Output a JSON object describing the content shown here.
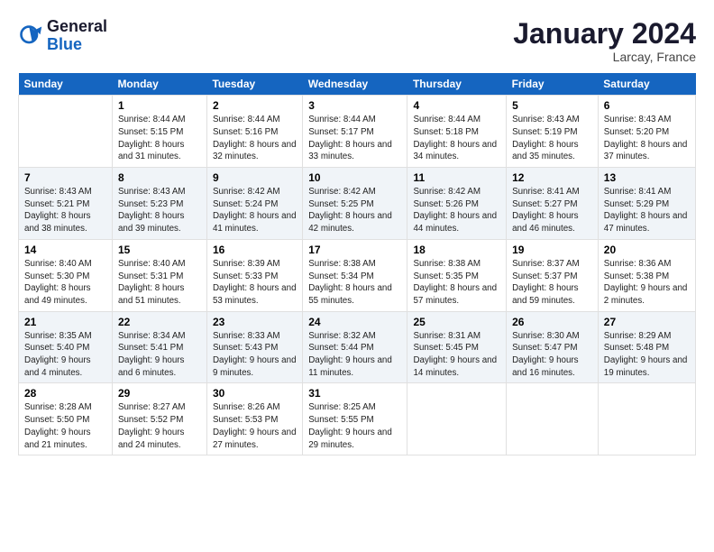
{
  "logo": {
    "line1": "General",
    "line2": "Blue"
  },
  "title": "January 2024",
  "location": "Larcay, France",
  "weekdays": [
    "Sunday",
    "Monday",
    "Tuesday",
    "Wednesday",
    "Thursday",
    "Friday",
    "Saturday"
  ],
  "weeks": [
    [
      {
        "day": "",
        "sunrise": "",
        "sunset": "",
        "daylight": ""
      },
      {
        "day": "1",
        "sunrise": "Sunrise: 8:44 AM",
        "sunset": "Sunset: 5:15 PM",
        "daylight": "Daylight: 8 hours and 31 minutes."
      },
      {
        "day": "2",
        "sunrise": "Sunrise: 8:44 AM",
        "sunset": "Sunset: 5:16 PM",
        "daylight": "Daylight: 8 hours and 32 minutes."
      },
      {
        "day": "3",
        "sunrise": "Sunrise: 8:44 AM",
        "sunset": "Sunset: 5:17 PM",
        "daylight": "Daylight: 8 hours and 33 minutes."
      },
      {
        "day": "4",
        "sunrise": "Sunrise: 8:44 AM",
        "sunset": "Sunset: 5:18 PM",
        "daylight": "Daylight: 8 hours and 34 minutes."
      },
      {
        "day": "5",
        "sunrise": "Sunrise: 8:43 AM",
        "sunset": "Sunset: 5:19 PM",
        "daylight": "Daylight: 8 hours and 35 minutes."
      },
      {
        "day": "6",
        "sunrise": "Sunrise: 8:43 AM",
        "sunset": "Sunset: 5:20 PM",
        "daylight": "Daylight: 8 hours and 37 minutes."
      }
    ],
    [
      {
        "day": "7",
        "sunrise": "Sunrise: 8:43 AM",
        "sunset": "Sunset: 5:21 PM",
        "daylight": "Daylight: 8 hours and 38 minutes."
      },
      {
        "day": "8",
        "sunrise": "Sunrise: 8:43 AM",
        "sunset": "Sunset: 5:23 PM",
        "daylight": "Daylight: 8 hours and 39 minutes."
      },
      {
        "day": "9",
        "sunrise": "Sunrise: 8:42 AM",
        "sunset": "Sunset: 5:24 PM",
        "daylight": "Daylight: 8 hours and 41 minutes."
      },
      {
        "day": "10",
        "sunrise": "Sunrise: 8:42 AM",
        "sunset": "Sunset: 5:25 PM",
        "daylight": "Daylight: 8 hours and 42 minutes."
      },
      {
        "day": "11",
        "sunrise": "Sunrise: 8:42 AM",
        "sunset": "Sunset: 5:26 PM",
        "daylight": "Daylight: 8 hours and 44 minutes."
      },
      {
        "day": "12",
        "sunrise": "Sunrise: 8:41 AM",
        "sunset": "Sunset: 5:27 PM",
        "daylight": "Daylight: 8 hours and 46 minutes."
      },
      {
        "day": "13",
        "sunrise": "Sunrise: 8:41 AM",
        "sunset": "Sunset: 5:29 PM",
        "daylight": "Daylight: 8 hours and 47 minutes."
      }
    ],
    [
      {
        "day": "14",
        "sunrise": "Sunrise: 8:40 AM",
        "sunset": "Sunset: 5:30 PM",
        "daylight": "Daylight: 8 hours and 49 minutes."
      },
      {
        "day": "15",
        "sunrise": "Sunrise: 8:40 AM",
        "sunset": "Sunset: 5:31 PM",
        "daylight": "Daylight: 8 hours and 51 minutes."
      },
      {
        "day": "16",
        "sunrise": "Sunrise: 8:39 AM",
        "sunset": "Sunset: 5:33 PM",
        "daylight": "Daylight: 8 hours and 53 minutes."
      },
      {
        "day": "17",
        "sunrise": "Sunrise: 8:38 AM",
        "sunset": "Sunset: 5:34 PM",
        "daylight": "Daylight: 8 hours and 55 minutes."
      },
      {
        "day": "18",
        "sunrise": "Sunrise: 8:38 AM",
        "sunset": "Sunset: 5:35 PM",
        "daylight": "Daylight: 8 hours and 57 minutes."
      },
      {
        "day": "19",
        "sunrise": "Sunrise: 8:37 AM",
        "sunset": "Sunset: 5:37 PM",
        "daylight": "Daylight: 8 hours and 59 minutes."
      },
      {
        "day": "20",
        "sunrise": "Sunrise: 8:36 AM",
        "sunset": "Sunset: 5:38 PM",
        "daylight": "Daylight: 9 hours and 2 minutes."
      }
    ],
    [
      {
        "day": "21",
        "sunrise": "Sunrise: 8:35 AM",
        "sunset": "Sunset: 5:40 PM",
        "daylight": "Daylight: 9 hours and 4 minutes."
      },
      {
        "day": "22",
        "sunrise": "Sunrise: 8:34 AM",
        "sunset": "Sunset: 5:41 PM",
        "daylight": "Daylight: 9 hours and 6 minutes."
      },
      {
        "day": "23",
        "sunrise": "Sunrise: 8:33 AM",
        "sunset": "Sunset: 5:43 PM",
        "daylight": "Daylight: 9 hours and 9 minutes."
      },
      {
        "day": "24",
        "sunrise": "Sunrise: 8:32 AM",
        "sunset": "Sunset: 5:44 PM",
        "daylight": "Daylight: 9 hours and 11 minutes."
      },
      {
        "day": "25",
        "sunrise": "Sunrise: 8:31 AM",
        "sunset": "Sunset: 5:45 PM",
        "daylight": "Daylight: 9 hours and 14 minutes."
      },
      {
        "day": "26",
        "sunrise": "Sunrise: 8:30 AM",
        "sunset": "Sunset: 5:47 PM",
        "daylight": "Daylight: 9 hours and 16 minutes."
      },
      {
        "day": "27",
        "sunrise": "Sunrise: 8:29 AM",
        "sunset": "Sunset: 5:48 PM",
        "daylight": "Daylight: 9 hours and 19 minutes."
      }
    ],
    [
      {
        "day": "28",
        "sunrise": "Sunrise: 8:28 AM",
        "sunset": "Sunset: 5:50 PM",
        "daylight": "Daylight: 9 hours and 21 minutes."
      },
      {
        "day": "29",
        "sunrise": "Sunrise: 8:27 AM",
        "sunset": "Sunset: 5:52 PM",
        "daylight": "Daylight: 9 hours and 24 minutes."
      },
      {
        "day": "30",
        "sunrise": "Sunrise: 8:26 AM",
        "sunset": "Sunset: 5:53 PM",
        "daylight": "Daylight: 9 hours and 27 minutes."
      },
      {
        "day": "31",
        "sunrise": "Sunrise: 8:25 AM",
        "sunset": "Sunset: 5:55 PM",
        "daylight": "Daylight: 9 hours and 29 minutes."
      },
      {
        "day": "",
        "sunrise": "",
        "sunset": "",
        "daylight": ""
      },
      {
        "day": "",
        "sunrise": "",
        "sunset": "",
        "daylight": ""
      },
      {
        "day": "",
        "sunrise": "",
        "sunset": "",
        "daylight": ""
      }
    ]
  ]
}
